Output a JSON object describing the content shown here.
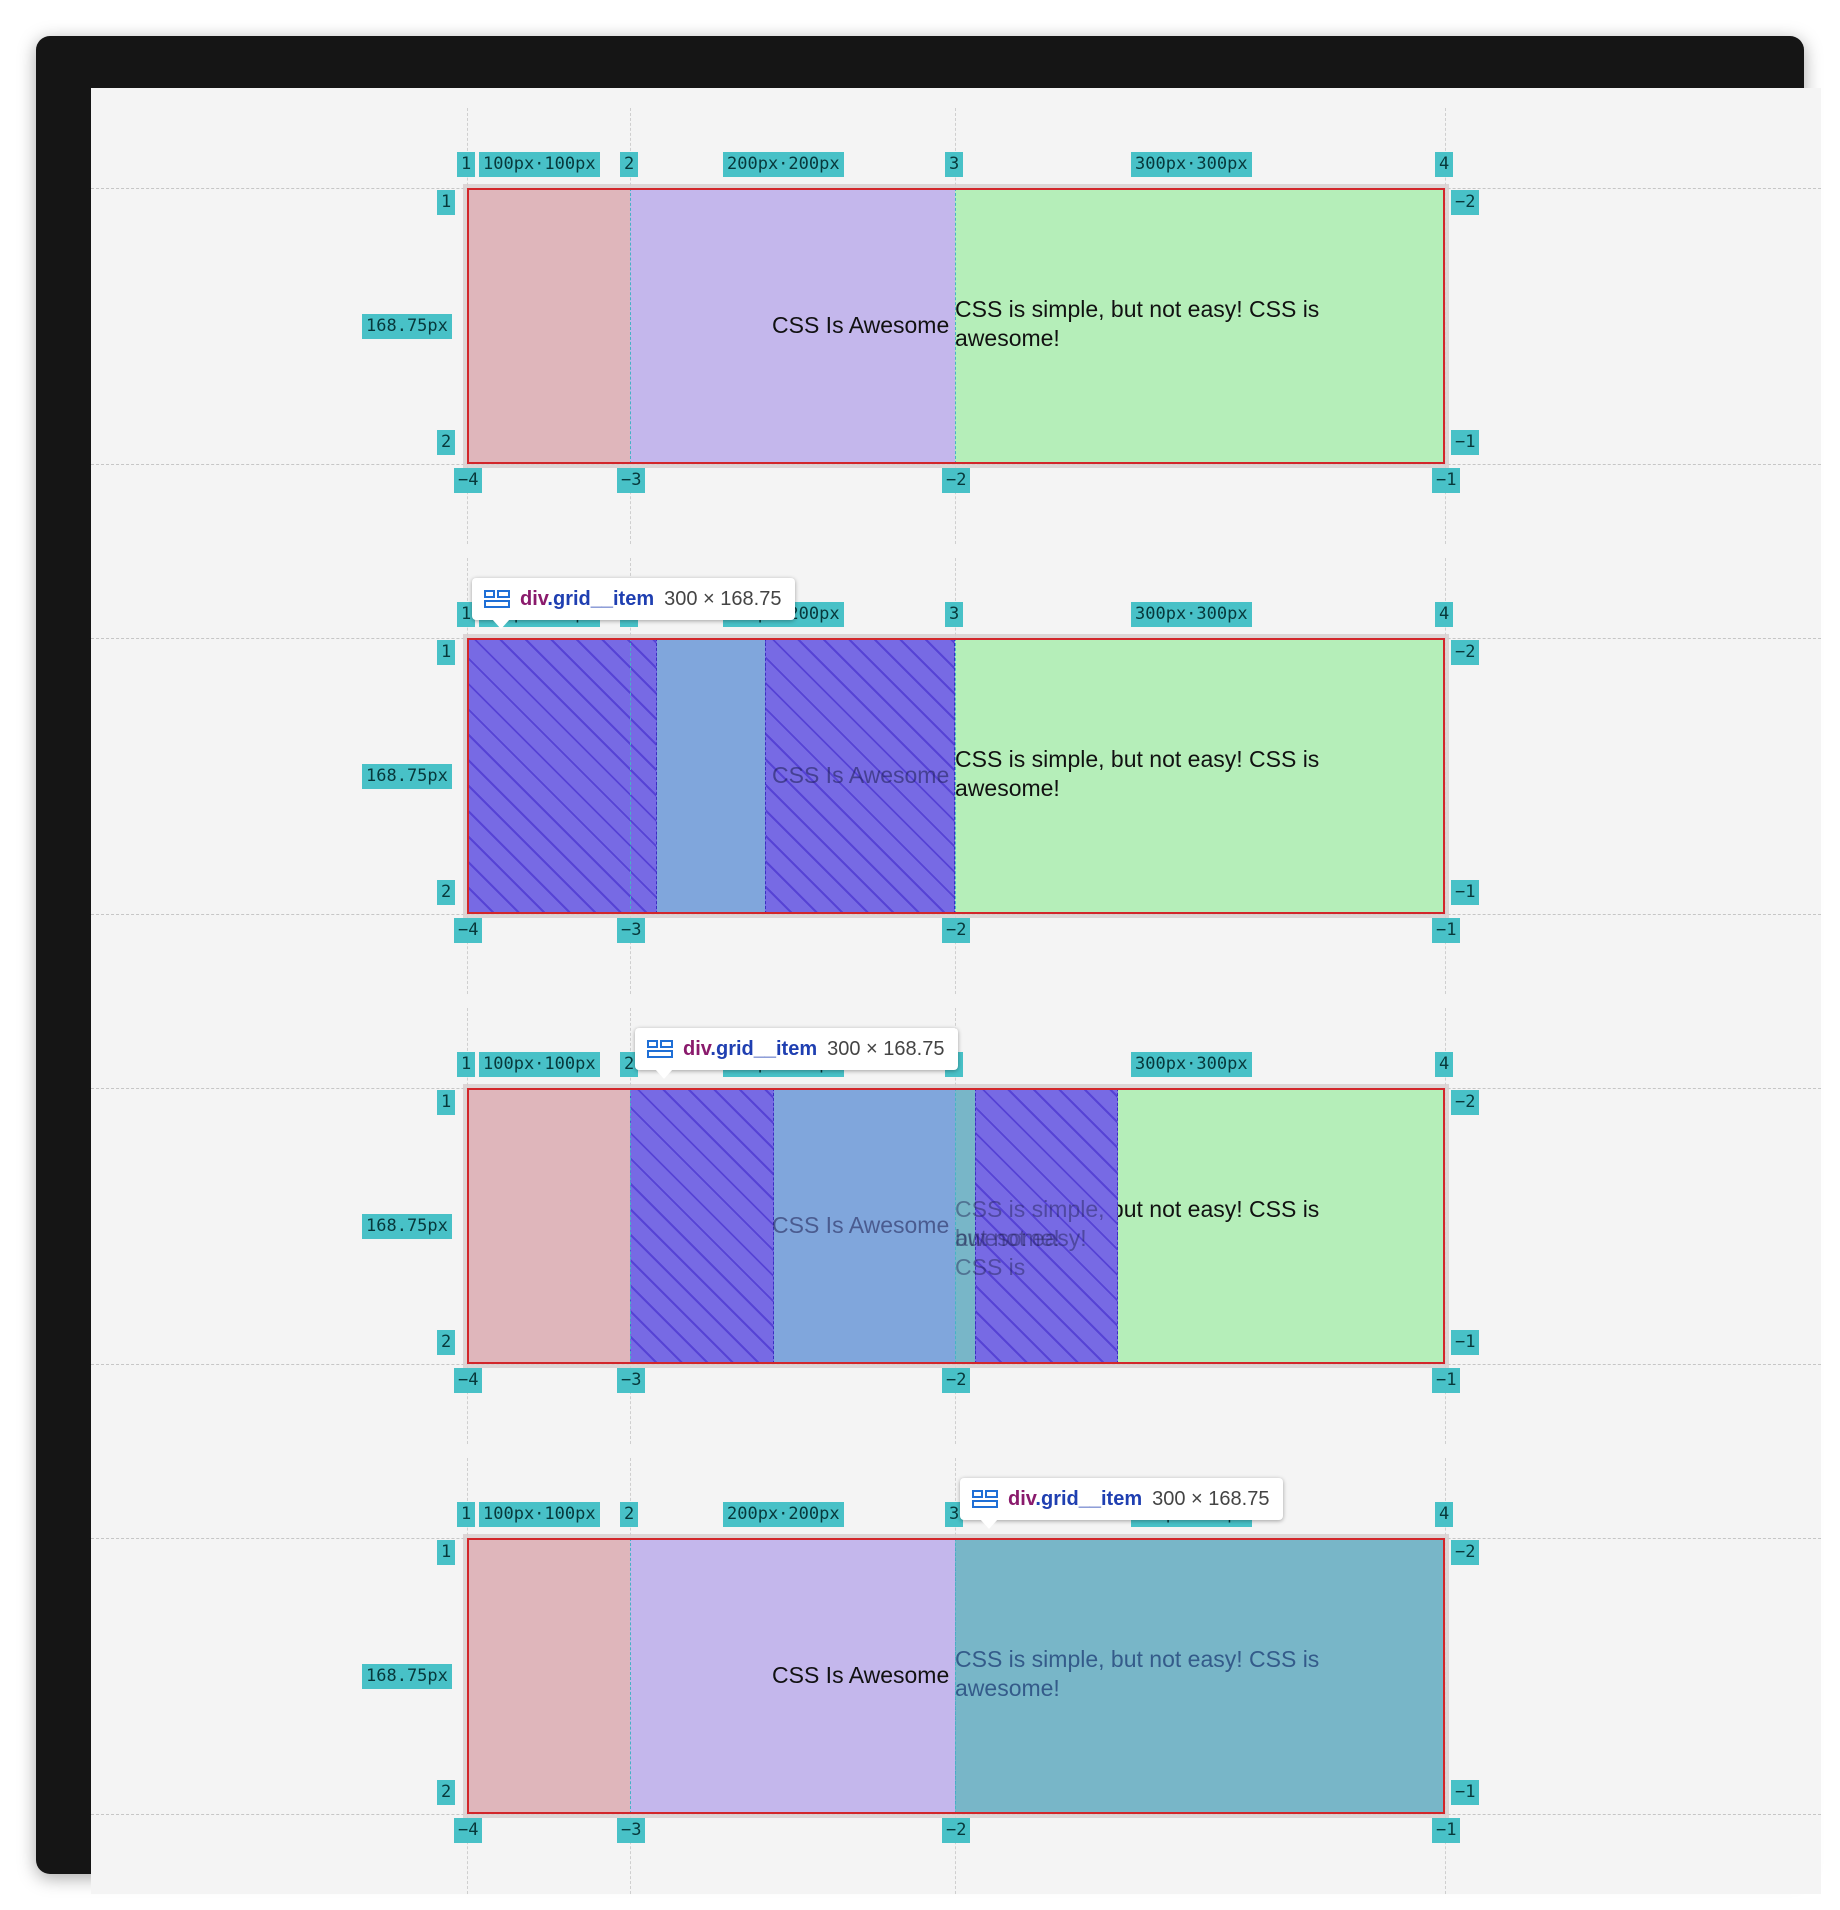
{
  "panels": [
    {
      "id": "panel-1",
      "hovered_item": null
    },
    {
      "id": "panel-2",
      "hovered_item": 1
    },
    {
      "id": "panel-3",
      "hovered_item": 2
    },
    {
      "id": "panel-4",
      "hovered_item": 3
    }
  ],
  "grid": {
    "column_lines_positive": [
      "1",
      "2",
      "3",
      "4"
    ],
    "column_lines_negative": [
      "−4",
      "−3",
      "−2",
      "−1"
    ],
    "row_lines_positive": [
      "1",
      "2"
    ],
    "row_lines_negative": [
      "−2",
      "−1"
    ],
    "track_sizes": [
      "100px·100px",
      "200px·200px",
      "300px·300px"
    ],
    "row_size": "168.75px"
  },
  "items": [
    {
      "text": ""
    },
    {
      "text": "CSS Is Awesome"
    },
    {
      "text_line1": "CSS is simple, but not easy! CSS is",
      "text_line2": "awesome!"
    }
  ],
  "tooltip": {
    "tag": "div",
    "class": ".grid__item",
    "dims": "300 × 168.75"
  },
  "colors": {
    "item1": "#dfb6bb",
    "item2": "#c4b7ec",
    "item3": "#b5eeb9",
    "hover_content": "#80a6dc",
    "hover_item3": "#78b6c8",
    "label_bg": "#48c1c7",
    "grid_border": "#d2262a"
  }
}
